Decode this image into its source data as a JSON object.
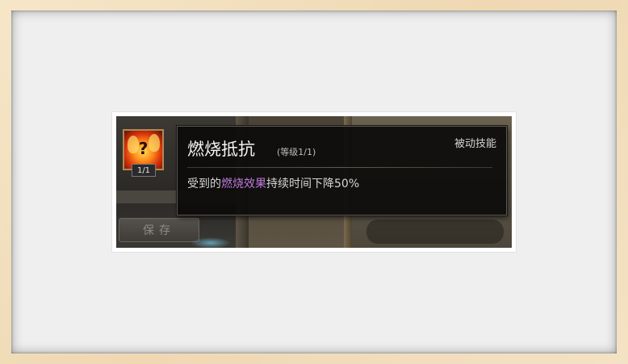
{
  "panel": {
    "save_label": "保存"
  },
  "skill": {
    "icon": "fire-resist-icon",
    "level_badge": "1/1"
  },
  "tooltip": {
    "title": "燃烧抵抗",
    "level": "(等级1/1)",
    "type": "被动技能",
    "description": {
      "prefix": "受到的",
      "highlight": "燃烧效果",
      "suffix": "持续时间下降50%"
    }
  },
  "colors": {
    "highlight": "#c07adf",
    "tooltip_bg": "#0c0b0a",
    "icon_border": "#b08a52"
  }
}
